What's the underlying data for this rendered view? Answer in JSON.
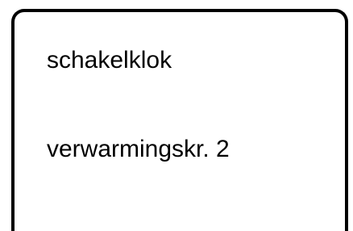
{
  "display": {
    "line1": "schakelklok",
    "line2": "verwarmingskr. 2"
  },
  "colors": {
    "border": "#000000",
    "background": "#ffffff",
    "text": "#000000"
  }
}
